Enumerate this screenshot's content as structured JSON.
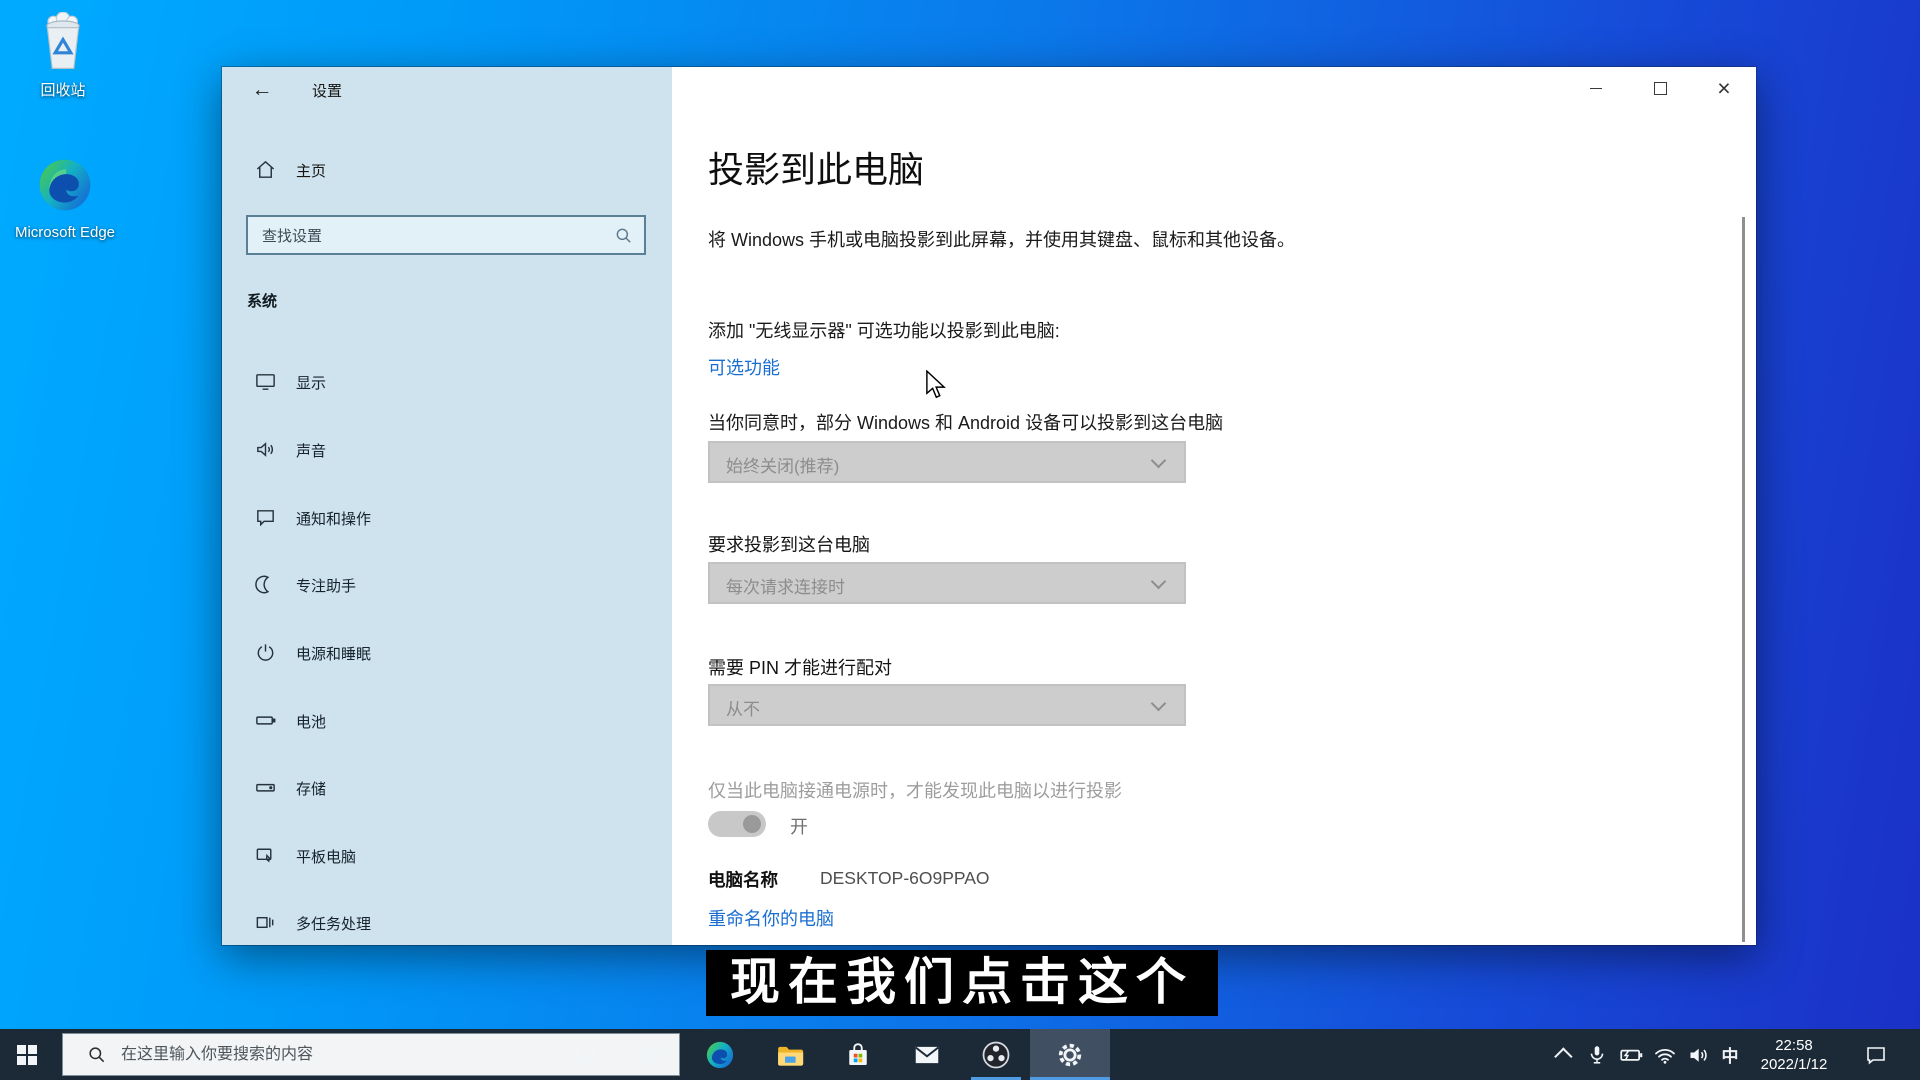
{
  "colors": {
    "desktop_left": "#00abff",
    "desktop_right": "#1b30c6",
    "sidebar_bg": "#cfe3ee",
    "taskbar_bg": "#1c2a38",
    "accent_underline": "#4f9be4",
    "link_blue": "#1a6ed0",
    "subtitle_bg": "#000000",
    "disabled_gray": "#cdcdcd"
  },
  "desktop": {
    "icons": [
      {
        "label": "回收站"
      },
      {
        "label": "Microsoft Edge"
      }
    ]
  },
  "settings_window": {
    "titlebar": {
      "back_glyph": "←",
      "title": "设置",
      "close_glyph": "×"
    },
    "sidebar": {
      "home_label": "主页",
      "search_placeholder": "查找设置",
      "section_header": "系统",
      "items": [
        {
          "label": "显示"
        },
        {
          "label": "声音"
        },
        {
          "label": "通知和操作"
        },
        {
          "label": "专注助手"
        },
        {
          "label": "电源和睡眠"
        },
        {
          "label": "电池"
        },
        {
          "label": "存储"
        },
        {
          "label": "平板电脑"
        },
        {
          "label": "多任务处理"
        }
      ]
    },
    "content": {
      "page_title": "投影到此电脑",
      "intro": "将 Windows 手机或电脑投影到此屏幕，并使用其键盘、鼠标和其他设备。",
      "optional_hint": "添加 \"无线显示器\" 可选功能以投影到此电脑:",
      "optional_link": "可选功能",
      "consent_text": "当你同意时，部分 Windows 和 Android 设备可以投影到这台电脑",
      "consent_value": "始终关闭(推荐)",
      "ask_label": "要求投影到这台电脑",
      "ask_value": "每次请求连接时",
      "pin_label": "需要 PIN 才能进行配对",
      "pin_value": "从不",
      "power_note": "仅当此电脑接通电源时，才能发现此电脑以进行投影",
      "toggle_state": "开",
      "pc_name_label": "电脑名称",
      "pc_name_value": "DESKTOP-6O9PPAO",
      "rename_link": "重命名你的电脑"
    }
  },
  "subtitle_overlay": {
    "text": "现在我们点击这个"
  },
  "taskbar": {
    "search_placeholder": "在这里输入你要搜索的内容",
    "tray": {
      "ime_indicator": "中",
      "time": "22:58",
      "date": "2022/1/12"
    }
  }
}
